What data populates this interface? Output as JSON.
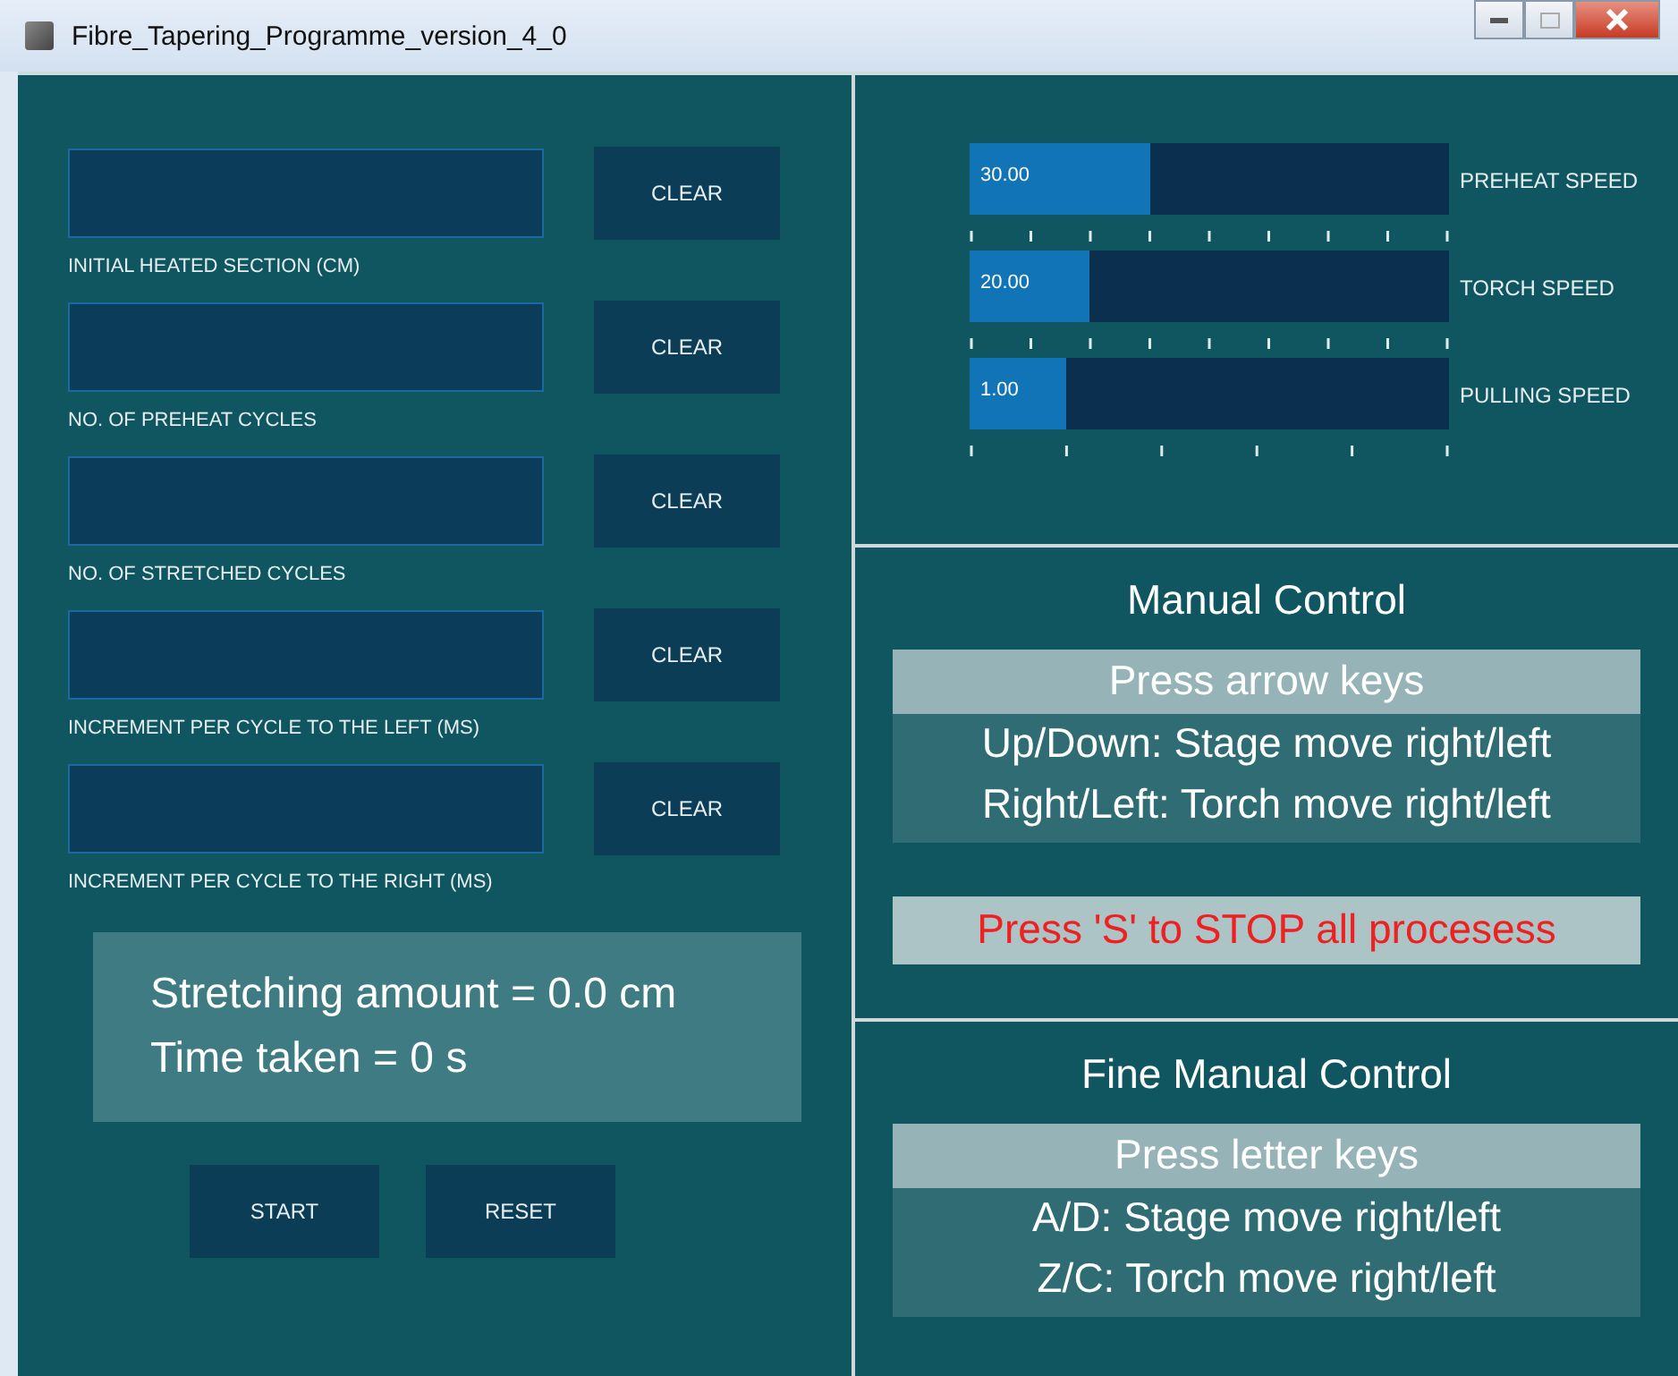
{
  "window": {
    "title": "Fibre_Tapering_Programme_version_4_0"
  },
  "inputs": [
    {
      "label": "INITIAL HEATED SECTION (CM)",
      "button": "CLEAR"
    },
    {
      "label": "NO. OF PREHEAT CYCLES",
      "button": "CLEAR"
    },
    {
      "label": "NO. OF STRETCHED CYCLES",
      "button": "CLEAR"
    },
    {
      "label": "INCREMENT PER CYCLE TO THE LEFT (MS)",
      "button": "CLEAR"
    },
    {
      "label": "INCREMENT PER CYCLE TO THE RIGHT (MS)",
      "button": "CLEAR"
    }
  ],
  "readout": [
    "Stretching amount = 0.0 cm",
    "Time taken = 0 s"
  ],
  "buttons": [
    "START",
    "RESET"
  ],
  "sliders": [
    {
      "label": "PREHEAT SPEED",
      "reading": "30.00",
      "level": 0.375,
      "kind": "fine"
    },
    {
      "label": "TORCH SPEED",
      "reading": "20.00",
      "level": 0.25,
      "kind": "fine"
    },
    {
      "label": "PULLING SPEED",
      "reading": "1.00",
      "level": 0.2,
      "kind": "coarse"
    }
  ],
  "manual_control": {
    "title": "Manual Control",
    "header": "Press arrow keys",
    "lines": [
      "Up/Down: Stage move right/left",
      "Right/Left: Torch move right/left"
    ],
    "warning": "Press 'S' to STOP all procesess"
  },
  "fine_manual_control": {
    "title": "Fine Manual Control",
    "header": "Press letter keys",
    "lines": [
      "A/D: Stage move right/left",
      "Z/C: Torch move right/left"
    ]
  }
}
